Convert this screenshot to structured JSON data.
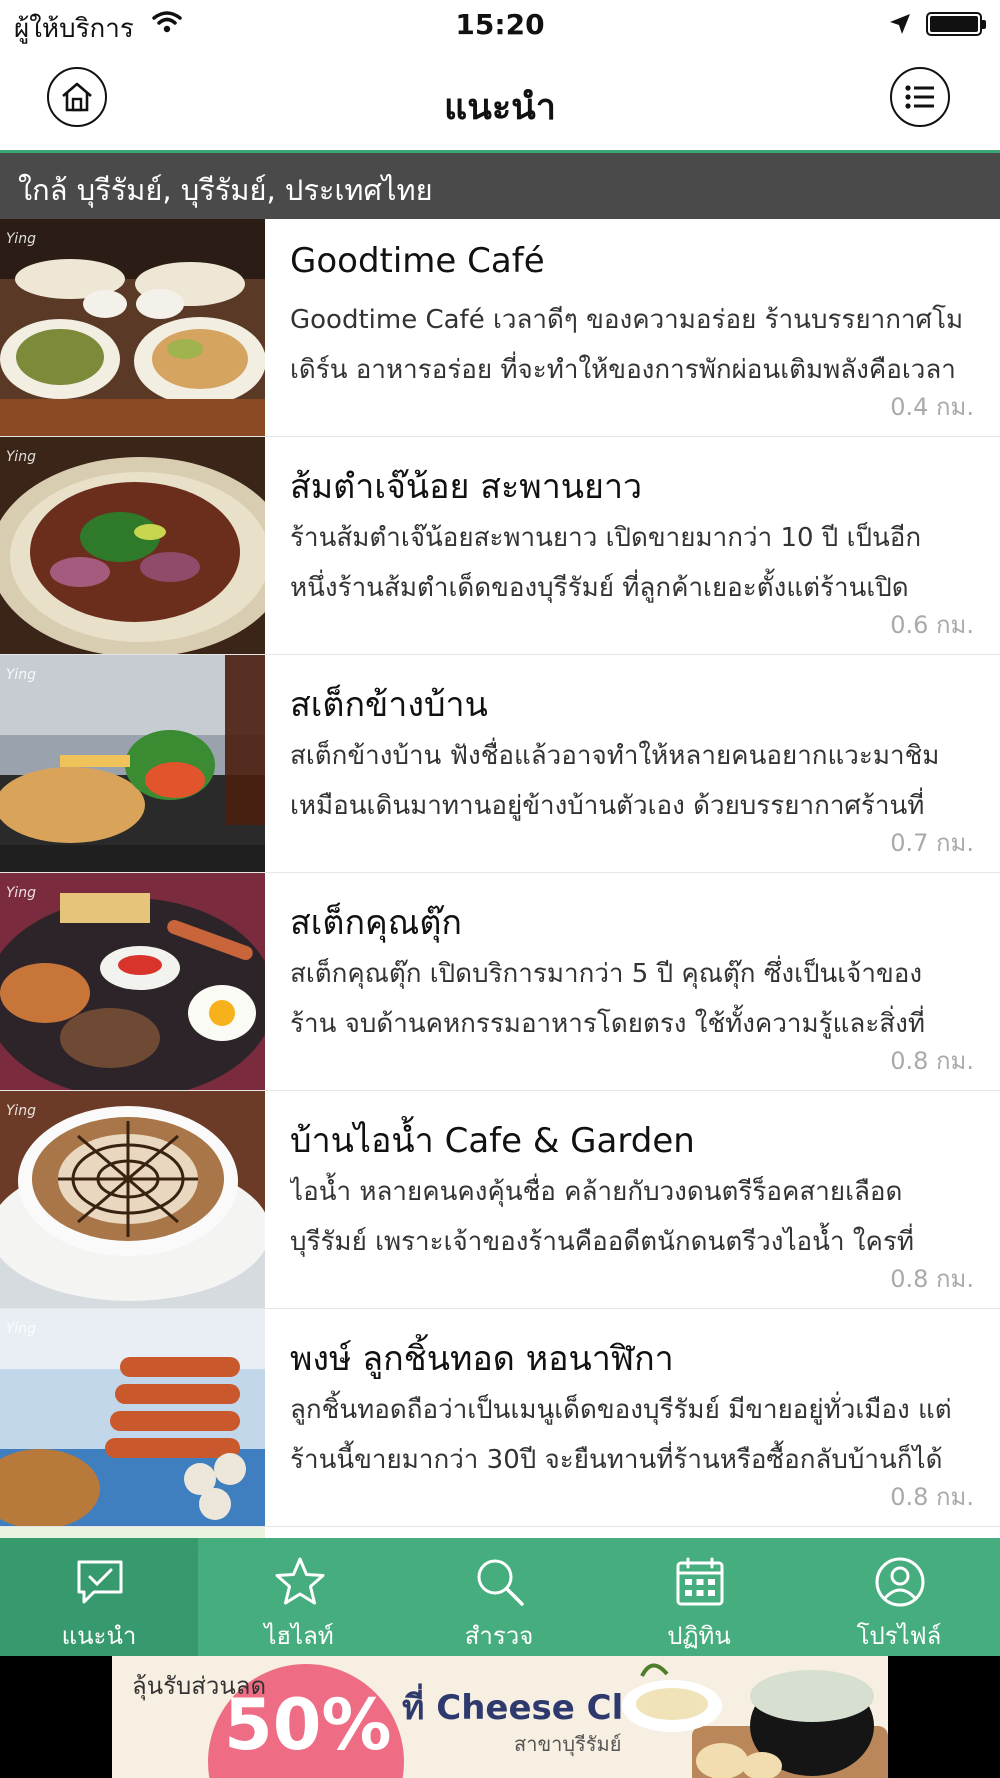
{
  "status_bar": {
    "carrier": "ผู้ให้บริการ",
    "time": "15:20"
  },
  "nav": {
    "title": "แนะนำ",
    "home_icon": "home-icon",
    "menu_icon": "list-icon"
  },
  "location": "ใกล้ บุรีรัมย์, บุรีรัมย์, ประเทศไทย",
  "places": [
    {
      "name": "Goodtime Café",
      "desc1": "Goodtime Café เวลาดีๆ ของความอร่อย ร้านบรรยากาศโม",
      "desc2": "เดิร์น อาหารอร่อย ที่จะทำให้ของการพักผ่อนเติมพลังคือเวลา",
      "distance": "0.4 กม."
    },
    {
      "name": "ส้มตำเจ๊น้อย สะพานยาว",
      "desc1": "ร้านส้มตำเจ๊น้อยสะพานยาว เปิดขายมากว่า 10 ปี เป็นอีก",
      "desc2": "หนึ่งร้านส้มตำเด็ดของบุรีรัมย์ ที่ลูกค้าเยอะตั้งแต่ร้านเปิด",
      "distance": "0.6 กม."
    },
    {
      "name": "สเต็กข้างบ้าน",
      "desc1": "สเต็กข้างบ้าน ฟังชื่อแล้วอาจทำให้หลายคนอยากแวะมาชิม",
      "desc2": "เหมือนเดินมาทานอยู่ข้างบ้านตัวเอง ด้วยบรรยากาศร้านที่",
      "distance": "0.7 กม."
    },
    {
      "name": "สเต็กคุณตุ๊ก",
      "desc1": "สเต็กคุณตุ๊ก เปิดบริการมากว่า 5 ปี คุณตุ๊ก ซึ่งเป็นเจ้าของ",
      "desc2": "ร้าน จบด้านคหกรรมอาหารโดยตรง ใช้ทั้งความรู้และสิ่งที่",
      "distance": "0.8 กม."
    },
    {
      "name": "บ้านไอน้ำ Cafe & Garden",
      "desc1": "ไอน้ำ หลายคนคงคุ้นชื่อ คล้ายกับวงดนตรีร็อคสายเลือด",
      "desc2": "บุรีรัมย์ เพราะเจ้าของร้านคืออดีตนักดนตรีวงไอน้ำ ใครที่",
      "distance": "0.8 กม."
    },
    {
      "name": "พงษ์ ลูกชิ้นทอด หอนาฬิกา",
      "desc1": "ลูกชิ้นทอดถือว่าเป็นเมนูเด็ดของบุรีรัมย์ มีขายอยู่ทั่วเมือง แต่",
      "desc2": "ร้านนี้ขายมากว่า 30ปี จะยืนทานที่ร้านหรือซื้อกลับบ้านก็ได้",
      "distance": "0.8 กม."
    }
  ],
  "tabs": [
    {
      "label": "แนะนำ",
      "icon": "chat-check-icon",
      "active": true
    },
    {
      "label": "ไฮไลท์",
      "icon": "star-icon",
      "active": false
    },
    {
      "label": "สำรวจ",
      "icon": "search-icon",
      "active": false
    },
    {
      "label": "ปฏิทิน",
      "icon": "calendar-icon",
      "active": false
    },
    {
      "label": "โปรไฟล์",
      "icon": "user-icon",
      "active": false
    }
  ],
  "ad": {
    "promo_top": "ลุ้นรับส่วนลด",
    "percent": "50%",
    "club": "ที่ Cheese Club",
    "branch": "สาขาบุรีรัมย์"
  },
  "colors": {
    "accent": "#3aa876",
    "location_bar": "#4a4a4a",
    "ad_circle": "#ee6d84"
  }
}
